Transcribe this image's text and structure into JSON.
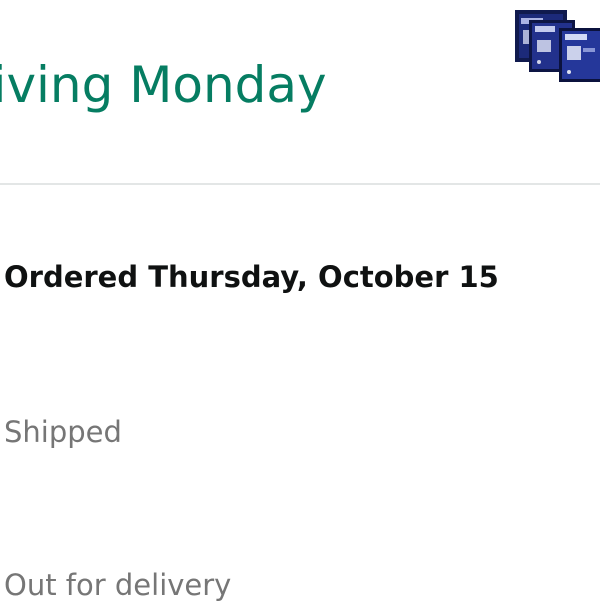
{
  "header": {
    "arrival_text": "riving Monday",
    "product_image_icon": "product-package-image"
  },
  "tracking": {
    "steps": [
      {
        "label": "Ordered Thursday, October 15",
        "state": "complete"
      },
      {
        "label": "Shipped",
        "state": "pending"
      },
      {
        "label": "Out for delivery",
        "state": "pending"
      }
    ]
  },
  "colors": {
    "accent_green": "#067d62",
    "text_dark": "#0f1111",
    "text_muted": "#767676",
    "divider": "#e3e6e6",
    "package_navy": "#1c2a7a"
  }
}
